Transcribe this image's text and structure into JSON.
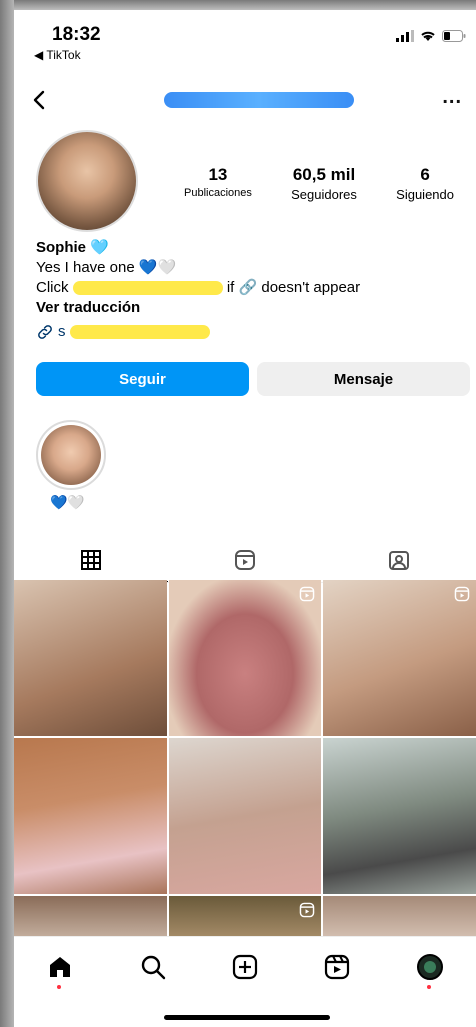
{
  "status_bar": {
    "time": "18:32",
    "back_app": "◀ TikTok"
  },
  "nav": {
    "username": "username_hidden",
    "more": "..."
  },
  "profile": {
    "stats": [
      {
        "value": "13",
        "label": "Publicaciones"
      },
      {
        "value": "60,5 mil",
        "label": "Seguidores"
      },
      {
        "value": "6",
        "label": "Siguiendo"
      }
    ],
    "name": "Sophie",
    "name_emoji": "🩵",
    "bio_line1": "Yes I have one",
    "bio_line1_emoji": "💙🤍",
    "bio_line2_prefix": "Click",
    "bio_line2_suffix": "if 🔗 doesn't appear",
    "translate": "Ver traducción",
    "link_prefix": "s"
  },
  "buttons": {
    "follow": "Seguir",
    "message": "Mensaje"
  },
  "highlight": {
    "label": "💙🤍"
  },
  "tabs": [
    {
      "name": "grid-icon",
      "active": true
    },
    {
      "name": "reels-icon",
      "active": false
    },
    {
      "name": "tagged-icon",
      "active": false
    }
  ],
  "grid_colors": [
    "#b28a6d",
    "#c97b7b",
    "#c9a187",
    "#b27a5a",
    "#cfbfb0",
    "#9aa6a0",
    "#8a6b55",
    "#7a6440",
    "#a68d7a"
  ],
  "bottom_nav": [
    "home-icon",
    "search-icon",
    "create-icon",
    "reels-icon",
    "profile-icon"
  ]
}
